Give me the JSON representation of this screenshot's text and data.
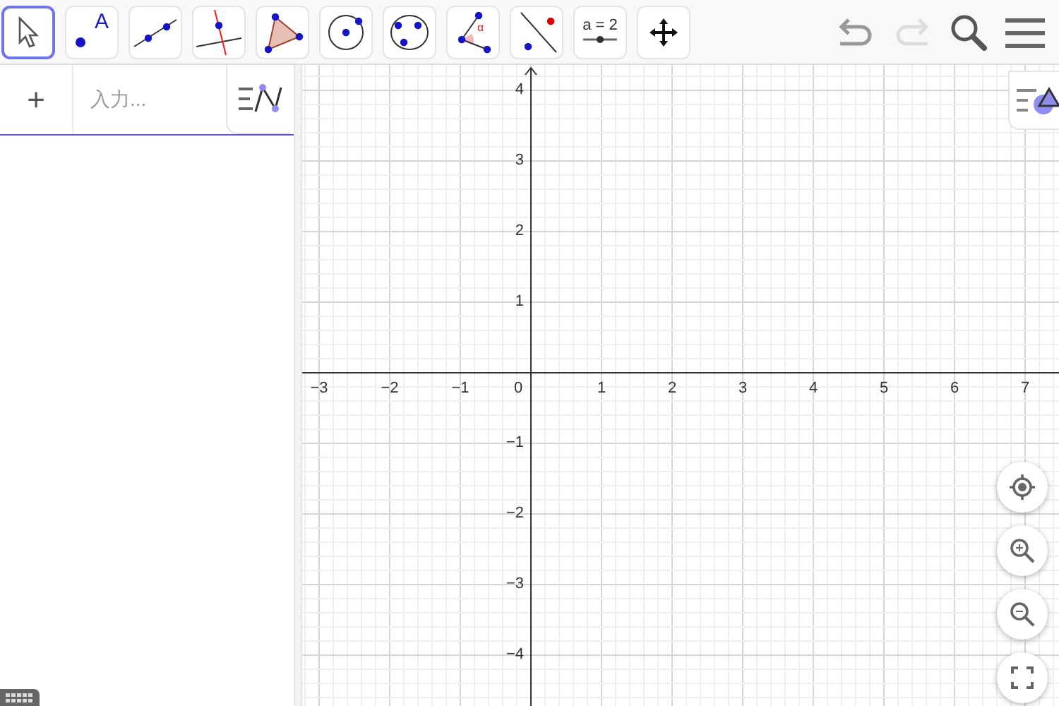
{
  "toolbar": {
    "tools": [
      {
        "kind": "move",
        "selected": true
      },
      {
        "kind": "point",
        "label": "A",
        "selected": false
      },
      {
        "kind": "line",
        "selected": false
      },
      {
        "kind": "perpendicular",
        "selected": false
      },
      {
        "kind": "polygon",
        "selected": false
      },
      {
        "kind": "circle",
        "selected": false
      },
      {
        "kind": "circle3",
        "selected": false
      },
      {
        "kind": "angle",
        "label": "α",
        "selected": false
      },
      {
        "kind": "reflect",
        "selected": false
      },
      {
        "kind": "slider",
        "label": "a = 2",
        "selected": false
      },
      {
        "kind": "pan",
        "selected": false
      }
    ],
    "undo": {
      "disabled": false
    },
    "redo": {
      "disabled": true
    }
  },
  "algebra": {
    "input": {
      "add": "+",
      "placeholder": "入力..."
    }
  },
  "graphics": {
    "x_labels_negative": [
      "−3",
      "−2",
      "−1"
    ],
    "origin_label": "0",
    "x_labels_positive": [
      "1",
      "2",
      "3",
      "4",
      "5",
      "6",
      "7"
    ],
    "y_labels_positive": [
      "4",
      "3",
      "2",
      "1"
    ],
    "y_labels_negative": [
      "−1",
      "−2",
      "−3",
      "−4"
    ]
  }
}
